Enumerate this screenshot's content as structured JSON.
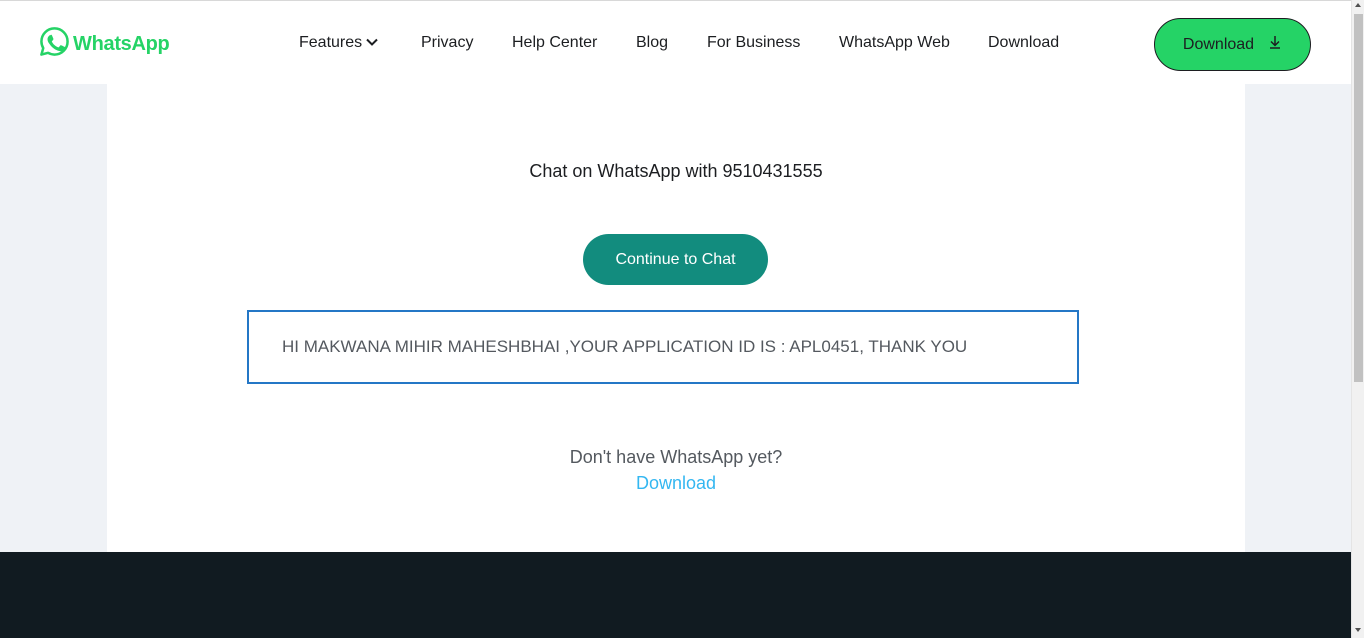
{
  "header": {
    "logo_text": "WhatsApp",
    "nav": [
      {
        "label": "Features",
        "has_dropdown": true
      },
      {
        "label": "Privacy"
      },
      {
        "label": "Help Center"
      },
      {
        "label": "Blog"
      },
      {
        "label": "For Business"
      },
      {
        "label": "WhatsApp Web"
      },
      {
        "label": "Download"
      }
    ],
    "download_button": "Download"
  },
  "main": {
    "chat_title": "Chat on WhatsApp with 9510431555",
    "continue_button": "Continue to Chat",
    "message": "HI MAKWANA MIHIR MAHESHBHAI ,YOUR APPLICATION ID IS : APL0451, THANK YOU",
    "no_whatsapp_text": "Don't have WhatsApp yet?",
    "download_link": "Download"
  },
  "colors": {
    "brand_green": "#25d366",
    "teal": "#128c7e",
    "link_blue": "#34b7f1",
    "footer_dark": "#111b21"
  }
}
